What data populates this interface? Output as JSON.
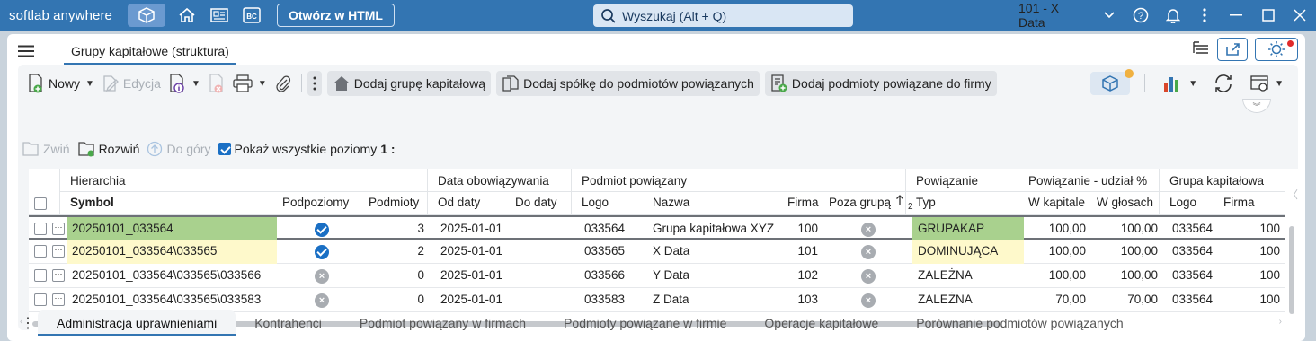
{
  "app": {
    "brand": "softlab anywhere",
    "html_button": "Otwórz w HTML",
    "search_placeholder": "Wyszukaj (Alt + Q)",
    "company": "101 - X Data"
  },
  "tab": {
    "title": "Grupy kapitałowe (struktura)"
  },
  "toolbar": {
    "new": "Nowy",
    "edit": "Edycja",
    "add_group": "Dodaj grupę kapitałową",
    "add_company": "Dodaj spółkę do podmiotów powiązanych",
    "add_related": "Dodaj podmioty powiązane do firmy"
  },
  "toolbar2": {
    "collapse": "Zwiń",
    "expand": "Rozwiń",
    "up": "Do góry",
    "show_levels": "Pokaż wszystkie poziomy",
    "levels_value": "1 :"
  },
  "grid": {
    "groups": {
      "hierarchy": "Hierarchia",
      "validity": "Data obowiązywania",
      "related": "Podmiot powiązany",
      "link": "Powiązanie",
      "share": "Powiązanie - udział %",
      "group": "Grupa kapitałowa"
    },
    "columns": {
      "symbol": "Symbol",
      "sublevels": "Podpoziomy",
      "entities": "Podmioty",
      "from": "Od daty",
      "to": "Do daty",
      "logo": "Logo",
      "name": "Nazwa",
      "firm": "Firma",
      "outside": "Poza grupą",
      "sort_index": "2",
      "type": "Typ",
      "capital": "W kapitale",
      "votes": "W głosach",
      "g_logo": "Logo",
      "g_firm": "Firma"
    },
    "rows": [
      {
        "symbol": "20250101_033564",
        "sub": true,
        "count": "3",
        "from": "2025-01-01",
        "to": "",
        "logo": "033564",
        "name": "Grupa kapitałowa XYZ",
        "firm": "100",
        "type": "GRUPAKAP",
        "capital": "100,00",
        "votes": "100,00",
        "glogo": "033564",
        "gfirm": "100"
      },
      {
        "symbol": "20250101_033564\\033565",
        "sub": true,
        "count": "2",
        "from": "2025-01-01",
        "to": "",
        "logo": "033565",
        "name": "X Data",
        "firm": "101",
        "type": "DOMINUJĄCA",
        "capital": "100,00",
        "votes": "100,00",
        "glogo": "033564",
        "gfirm": "100"
      },
      {
        "symbol": "20250101_033564\\033565\\033566",
        "sub": false,
        "count": "0",
        "from": "2025-01-01",
        "to": "",
        "logo": "033566",
        "name": "Y Data",
        "firm": "102",
        "type": "ZALEŻNA",
        "capital": "100,00",
        "votes": "100,00",
        "glogo": "033564",
        "gfirm": "100"
      },
      {
        "symbol": "20250101_033564\\033565\\033583",
        "sub": false,
        "count": "0",
        "from": "2025-01-01",
        "to": "",
        "logo": "033583",
        "name": "Z Data",
        "firm": "103",
        "type": "ZALEŻNA",
        "capital": "70,00",
        "votes": "70,00",
        "glogo": "033564",
        "gfirm": "100"
      }
    ]
  },
  "bottom_tabs": [
    "Administracja uprawnieniami",
    "Kontrahenci",
    "Podmiot powiązany w firmach",
    "Podmioty powiązane w firmie",
    "Operacje kapitałowe",
    "Porównanie podmiotów powiązanych"
  ],
  "colors": {
    "titlebar": "#3375b2",
    "green": "#a9d18e",
    "yellow": "#fef9cb",
    "check_blue": "#1a6fc4"
  },
  "icons": [
    "cube-icon",
    "home-icon",
    "news-icon",
    "bc-icon",
    "search-icon",
    "help-icon",
    "bell-icon",
    "kebab-icon",
    "minimize-icon",
    "maximize-icon",
    "close-icon"
  ]
}
